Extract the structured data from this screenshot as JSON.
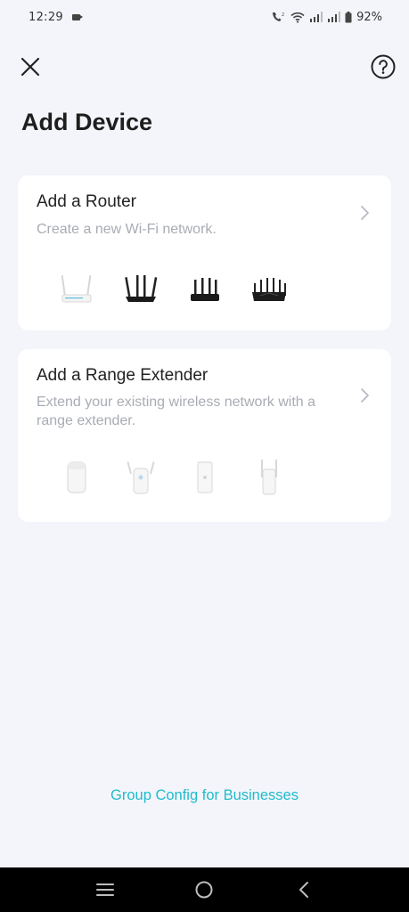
{
  "status_bar": {
    "time": "12:29",
    "battery": "92%"
  },
  "header": {
    "close_icon": "close-icon",
    "help_icon": "help-circle-icon"
  },
  "page": {
    "title": "Add Device"
  },
  "cards": {
    "router": {
      "title": "Add a Router",
      "description": "Create a new Wi-Fi network.",
      "devices": [
        "router-white-antennas",
        "router-black-4-antennas",
        "router-black-compact",
        "router-black-6-antennas"
      ]
    },
    "extender": {
      "title": "Add a Range Extender",
      "description": "Extend your existing wireless network with a range extender.",
      "devices": [
        "extender-white-box",
        "extender-white-antennas",
        "extender-white-flat",
        "extender-white-side-antennas"
      ]
    }
  },
  "footer": {
    "link": "Group Config for Businesses"
  },
  "nav": {
    "recents": "recents-icon",
    "home": "home-icon",
    "back": "back-icon"
  },
  "colors": {
    "background": "#f4f5fa",
    "card": "#ffffff",
    "accent": "#1fbccd",
    "muted_text": "#a9acb4"
  }
}
